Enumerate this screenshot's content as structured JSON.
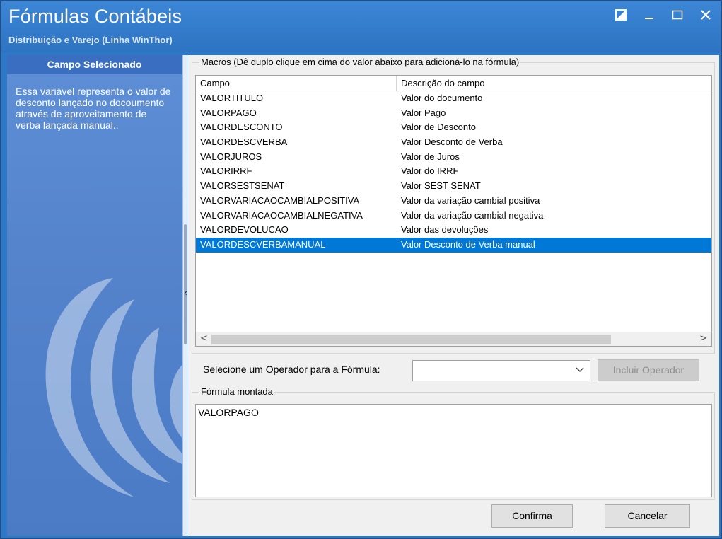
{
  "window": {
    "title": "Fórmulas Contábeis",
    "subtitle": "Distribuição e Varejo (Linha WinThor)"
  },
  "left_panel": {
    "header": "Campo Selecionado",
    "description": "Essa variável representa o valor de desconto lançado no docoumento através de aproveitamento de verba lançada manual.."
  },
  "macros": {
    "legend": "Macros (Dê duplo clique em cima do valor abaixo para adicioná-lo na fórmula)",
    "columns": [
      "Campo",
      "Descrição do campo"
    ],
    "rows": [
      {
        "campo": "VALORTITULO",
        "descricao": "Valor do documento"
      },
      {
        "campo": "VALORPAGO",
        "descricao": "Valor Pago"
      },
      {
        "campo": "VALORDESCONTO",
        "descricao": "Valor de Desconto"
      },
      {
        "campo": "VALORDESCVERBA",
        "descricao": "Valor Desconto de Verba"
      },
      {
        "campo": "VALORJUROS",
        "descricao": "Valor de Juros"
      },
      {
        "campo": "VALORIRRF",
        "descricao": "Valor do IRRF"
      },
      {
        "campo": "VALORSESTSENAT",
        "descricao": "Valor SEST SENAT"
      },
      {
        "campo": "VALORVARIACAOCAMBIALPOSITIVA",
        "descricao": "Valor da variação cambial positiva"
      },
      {
        "campo": "VALORVARIACAOCAMBIALNEGATIVA",
        "descricao": "Valor da variação cambial negativa"
      },
      {
        "campo": "VALORDEVOLUCAO",
        "descricao": "Valor das devoluções"
      },
      {
        "campo": "VALORDESCVERBAMANUAL",
        "descricao": "Valor Desconto de Verba manual"
      }
    ],
    "selected_index": 10
  },
  "operator": {
    "label": "Selecione um Operador para a Fórmula:",
    "selected_value": "",
    "button_label": "Incluir Operador"
  },
  "formula": {
    "legend": "Fórmula montada",
    "value": "VALORPAGO"
  },
  "actions": {
    "confirm_label": "Confirma",
    "cancel_label": "Cancelar"
  },
  "colors": {
    "titlebar": "#2e78c8",
    "left_panel": "#5584cc",
    "selection": "#0078d7"
  }
}
